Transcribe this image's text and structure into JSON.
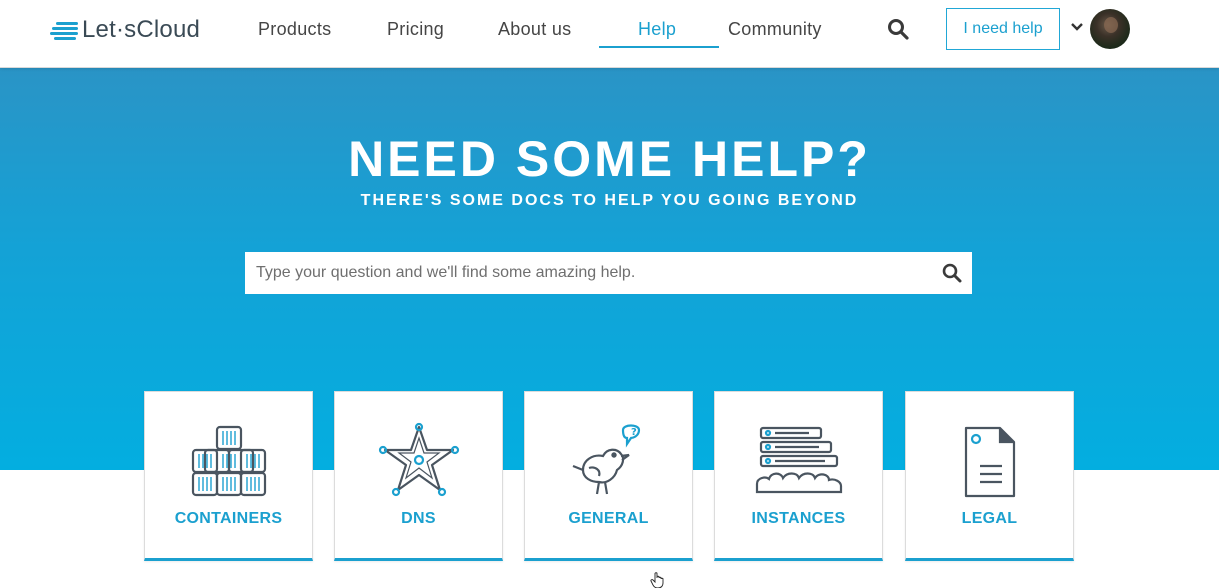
{
  "header": {
    "logo_text": "Let·sCloud",
    "nav": [
      {
        "label": "Products"
      },
      {
        "label": "Pricing"
      },
      {
        "label": "About us"
      },
      {
        "label": "Help",
        "active": true
      },
      {
        "label": "Community"
      }
    ],
    "search_icon": "search-icon",
    "help_button_label": "I need help",
    "dropdown_icon": "chevron-down-icon",
    "avatar": "user-avatar"
  },
  "hero": {
    "title": "NEED SOME HELP?",
    "subtitle": "THERE'S SOME DOCS TO HELP YOU GOING BEYOND",
    "search": {
      "placeholder": "Type your question and we'll find some amazing help.",
      "value": ""
    }
  },
  "categories": [
    {
      "label": "CONTAINERS",
      "icon": "containers-icon"
    },
    {
      "label": "DNS",
      "icon": "star-network-icon"
    },
    {
      "label": "GENERAL",
      "icon": "bird-question-icon"
    },
    {
      "label": "INSTANCES",
      "icon": "server-stack-icon"
    },
    {
      "label": "LEGAL",
      "icon": "document-icon"
    }
  ],
  "colors": {
    "accent": "#1ba0cf",
    "hero_top": "#2a94c6",
    "hero_bottom": "#03aee0",
    "text_dark": "#454545",
    "icon_stroke": "#4a5560"
  }
}
